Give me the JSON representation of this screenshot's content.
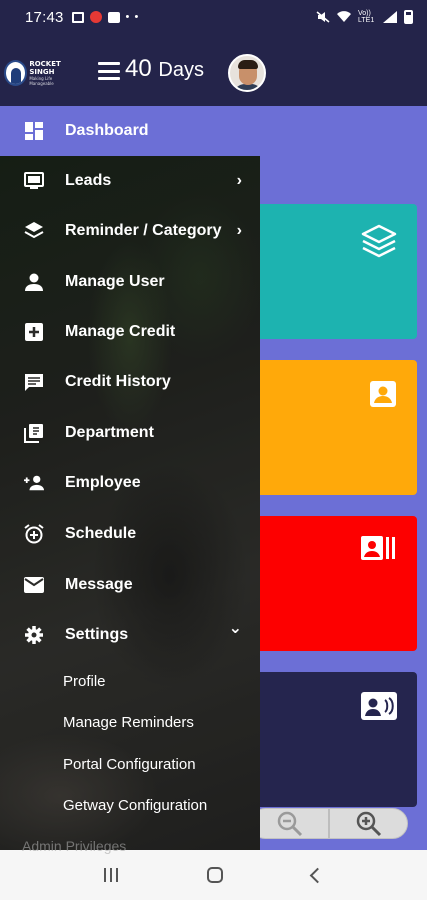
{
  "status_bar": {
    "time": "17:43",
    "network_text": "Vo)) LTE1"
  },
  "header": {
    "logo": {
      "line1": "ROCKET",
      "line2": "SINGH",
      "tagline": "Making Life Manageable"
    },
    "days_number": "40",
    "days_unit": "Days"
  },
  "drawer": {
    "items": [
      {
        "label": "Dashboard",
        "icon": "dashboard-icon"
      },
      {
        "label": "Leads",
        "icon": "monitor-icon",
        "arrow": "›"
      },
      {
        "label": "Reminder / Category",
        "icon": "layers-icon",
        "arrow": "›"
      },
      {
        "label": "Manage User",
        "icon": "person-icon"
      },
      {
        "label": "Manage Credit",
        "icon": "plus-box-icon"
      },
      {
        "label": "Credit History",
        "icon": "message-box-icon"
      },
      {
        "label": "Department",
        "icon": "library-icon"
      },
      {
        "label": "Employee",
        "icon": "person-add-icon"
      },
      {
        "label": "Schedule",
        "icon": "alarm-add-icon"
      },
      {
        "label": "Message",
        "icon": "mail-icon"
      },
      {
        "label": "Settings",
        "icon": "gear-icon",
        "arrow": "⌄"
      }
    ],
    "settings_sub": [
      {
        "label": "Profile"
      },
      {
        "label": "Manage Reminders"
      },
      {
        "label": "Portal Configuration"
      },
      {
        "label": "Getway Configuration"
      }
    ],
    "footer_label": "Admin Privileges"
  },
  "cards": [
    {
      "color": "#1db3b0",
      "icon": "layers-icon"
    },
    {
      "color": "#ffa90a",
      "icon": "contact-box-icon"
    },
    {
      "color": "#fd0000",
      "icon": "id-card-icon"
    },
    {
      "color": "#25254e",
      "icon": "contact-card-icon"
    }
  ],
  "colors": {
    "primary": "#24244a",
    "accent": "#6c6fd6"
  }
}
